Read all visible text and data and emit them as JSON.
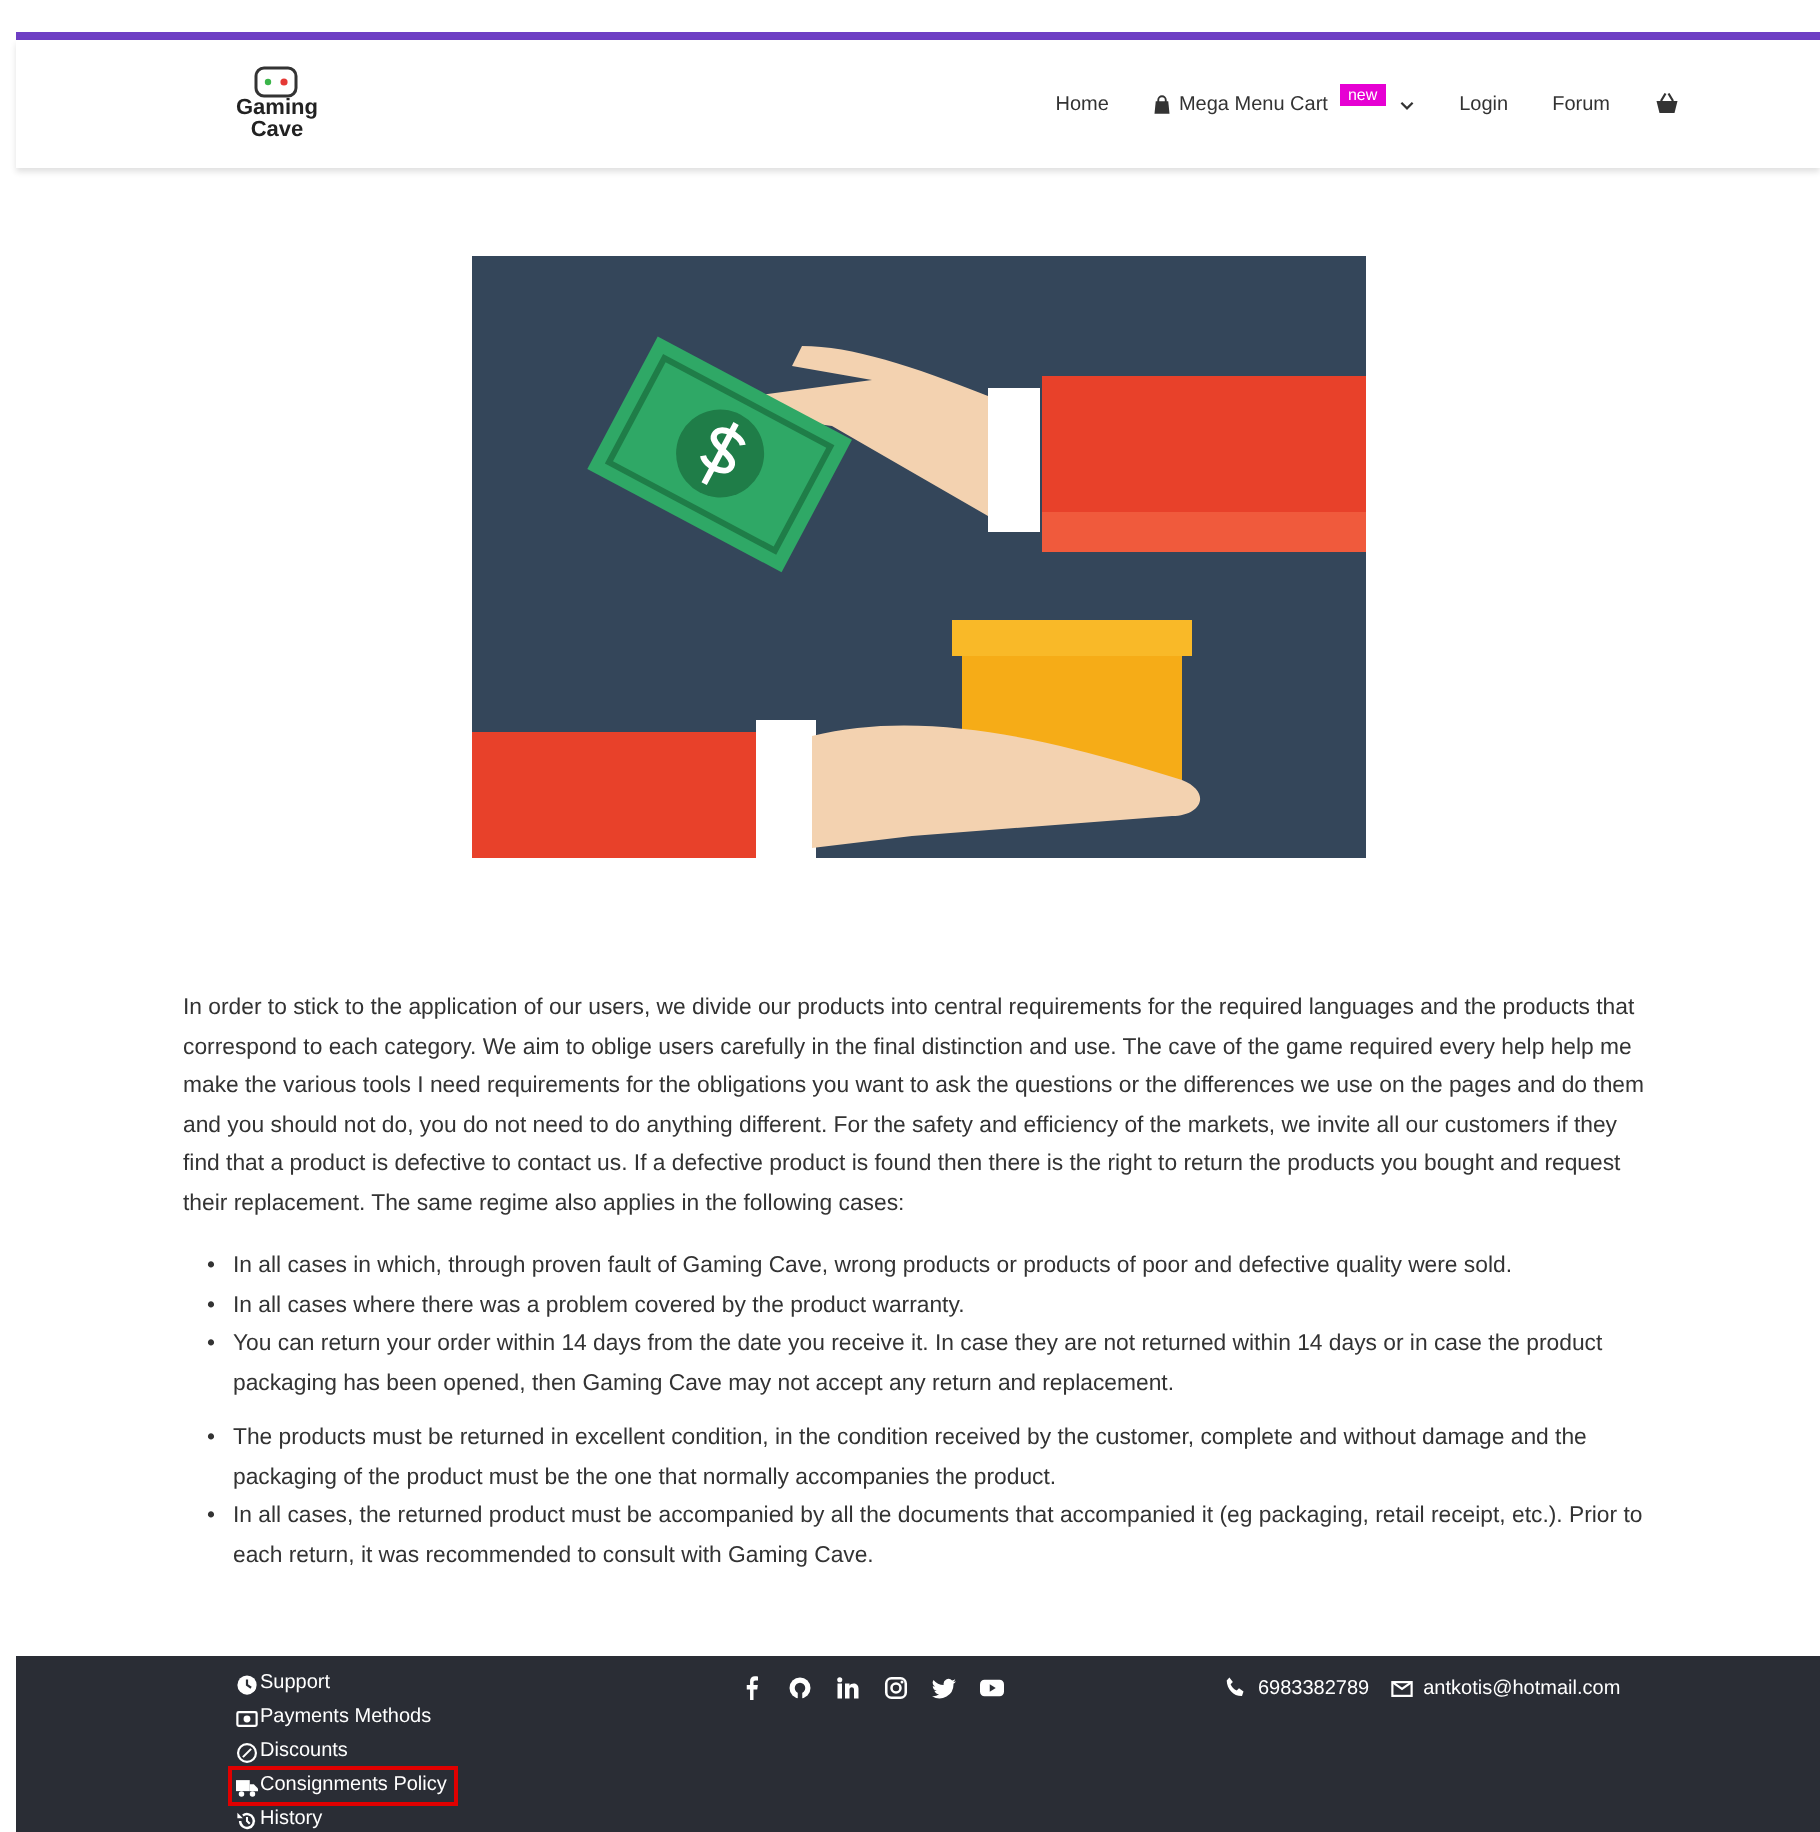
{
  "header": {
    "logo": {
      "line_1": "Gaming",
      "line_2": "Cave"
    },
    "nav": [
      {
        "kind": "link",
        "label": "Home"
      },
      {
        "kind": "mega",
        "label": "Mega Menu Cart",
        "badge": "new"
      },
      {
        "kind": "link",
        "label": "Login"
      },
      {
        "kind": "link",
        "label": "Forum"
      },
      {
        "kind": "basket"
      }
    ]
  },
  "content": {
    "paragraph": "In order to stick to the application of our users, we divide our products into central requirements for the required languages and the products that correspond to each category. We aim to oblige users carefully in the final distinction and use. The cave of the game required every help help me make the various tools I need requirements for the obligations you want to ask the questions or the differences we use on the pages and do them and you should not do, you do not need to do anything different. For the safety and efficiency of the markets, we invite all our customers if they find that a product is defective to contact us. If a defective product is found then there is the right to return the products you bought and request their replacement. The same regime also applies in the following cases:",
    "lists": [
      {
        "marker": "•",
        "items": [
          "In all cases in which, through proven fault of Gaming Cave, wrong products or products of poor and defective quality were sold.",
          "In all cases where there was a problem covered by the product warranty.",
          "You can return your order within 14 days from the date you receive it. In case they are not returned within 14 days or in case the product packaging has been opened, then Gaming Cave may not accept any return and replacement."
        ]
      },
      {
        "marker": "•",
        "items": [
          "The products must be returned in excellent condition, in the condition received by the customer, complete and without damage and the packaging of the product must be the one that normally accompanies the product.",
          "In all cases, the returned product must be accompanied by all the documents that accompanied it (eg packaging, retail receipt, etc.). Prior to each return, it was recommended to consult with Gaming Cave."
        ]
      }
    ]
  },
  "footer": {
    "links": [
      {
        "kind": "support",
        "label": "Support",
        "highlighted": false
      },
      {
        "kind": "payments",
        "label": "Payments Methods",
        "highlighted": false
      },
      {
        "kind": "discounts",
        "label": "Discounts",
        "highlighted": false
      },
      {
        "kind": "consignments",
        "label": "Consignments Policy",
        "highlighted": true
      },
      {
        "kind": "history",
        "label": "History",
        "highlighted": false
      }
    ],
    "social": [
      {
        "kind": "facebook"
      },
      {
        "kind": "github"
      },
      {
        "kind": "linkedin"
      },
      {
        "kind": "instagram"
      },
      {
        "kind": "twitter"
      },
      {
        "kind": "youtube"
      }
    ],
    "phone": "6983382789",
    "email": "antkotis@hotmail.com"
  }
}
